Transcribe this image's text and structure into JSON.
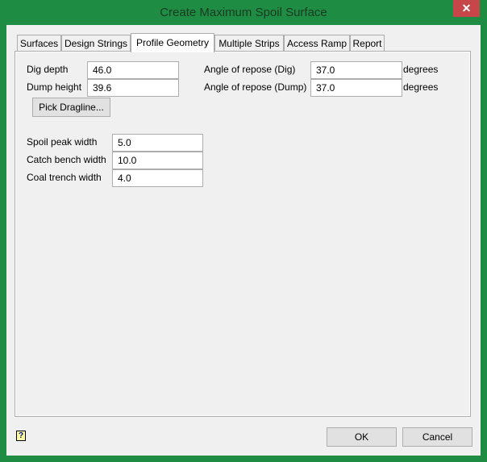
{
  "window": {
    "title": "Create Maximum Spoil Surface",
    "close": "✕"
  },
  "tabs": [
    {
      "label": "Surfaces"
    },
    {
      "label": "Design Strings"
    },
    {
      "label": "Profile Geometry"
    },
    {
      "label": "Multiple Strips"
    },
    {
      "label": "Access Ramp"
    },
    {
      "label": "Report"
    }
  ],
  "form": {
    "dig_depth": {
      "label": "Dig depth",
      "value": "46.0"
    },
    "dump_height": {
      "label": "Dump height",
      "value": "39.6"
    },
    "angle_dig": {
      "label": "Angle of repose (Dig)",
      "value": "37.0",
      "unit": "degrees"
    },
    "angle_dump": {
      "label": "Angle of repose (Dump)",
      "value": "37.0",
      "unit": "degrees"
    },
    "pick_dragline": "Pick Dragline...",
    "spoil_peak": {
      "label": "Spoil peak width",
      "value": "5.0"
    },
    "catch_bench": {
      "label": "Catch bench width",
      "value": "10.0"
    },
    "coal_trench": {
      "label": "Coal trench width",
      "value": "4.0"
    }
  },
  "footer": {
    "help": "?",
    "ok": "OK",
    "cancel": "Cancel"
  }
}
